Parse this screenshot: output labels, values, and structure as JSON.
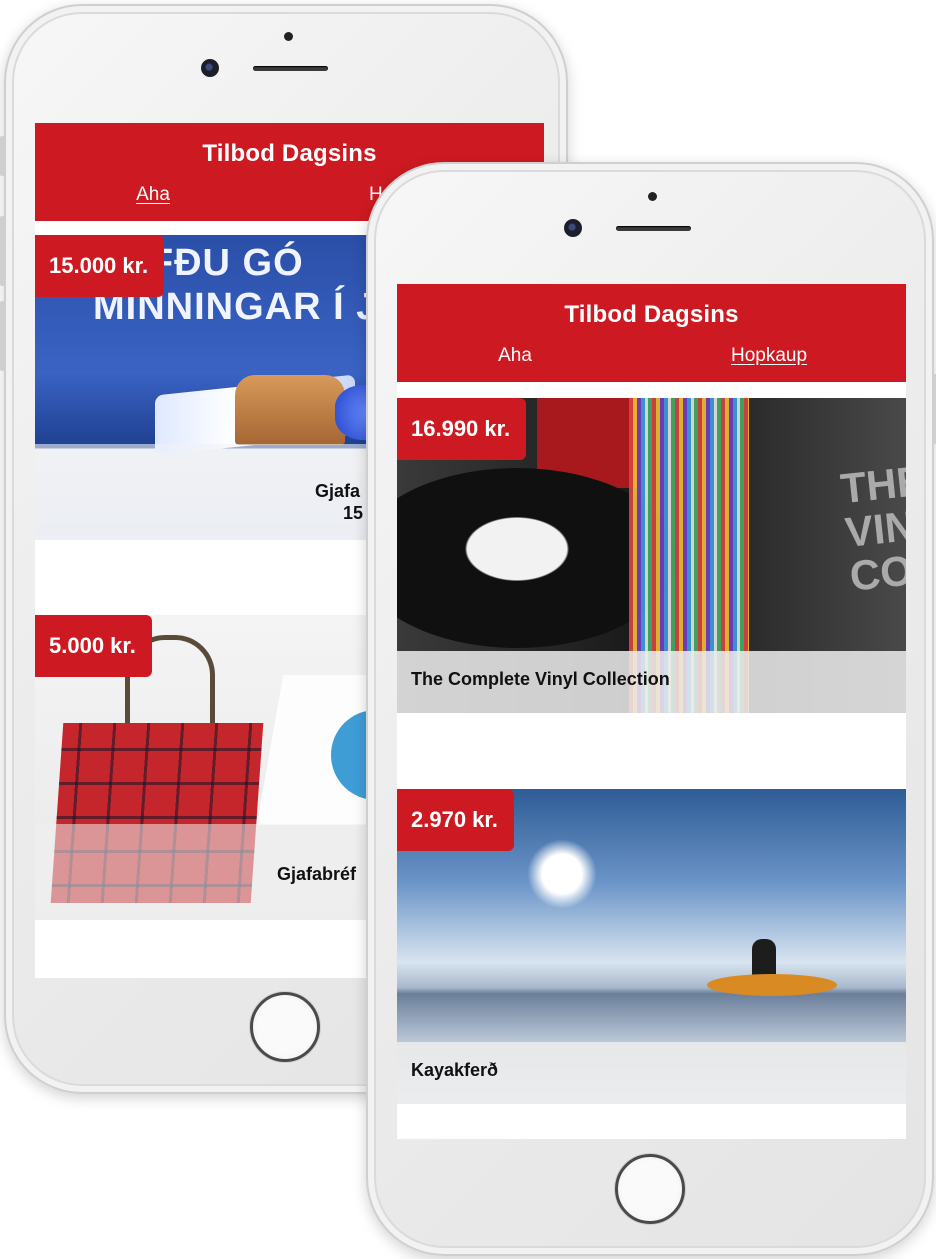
{
  "app": {
    "title": "Tilbod Dagsins",
    "tabs": [
      "Aha",
      "Hopkaup"
    ]
  },
  "left_phone": {
    "active_tab": "Aha",
    "deals": [
      {
        "price": "15.000 kr.",
        "banner_lines": [
          "GEFÐU GÓ",
          "MINNINGAR Í J"
        ],
        "caption_lines": [
          "Gjafa",
          "15"
        ]
      },
      {
        "price": "5.000 kr.",
        "caption": "Gjafabréf"
      }
    ]
  },
  "right_phone": {
    "active_tab": "Hopkaup",
    "deals": [
      {
        "price": "16.990 kr.",
        "caption": "The Complete Vinyl Collection",
        "box_text_lines": [
          "THE CO",
          "VIN",
          "COLLEC"
        ]
      },
      {
        "price": "2.970 kr.",
        "caption": "Kayakferð"
      }
    ]
  }
}
